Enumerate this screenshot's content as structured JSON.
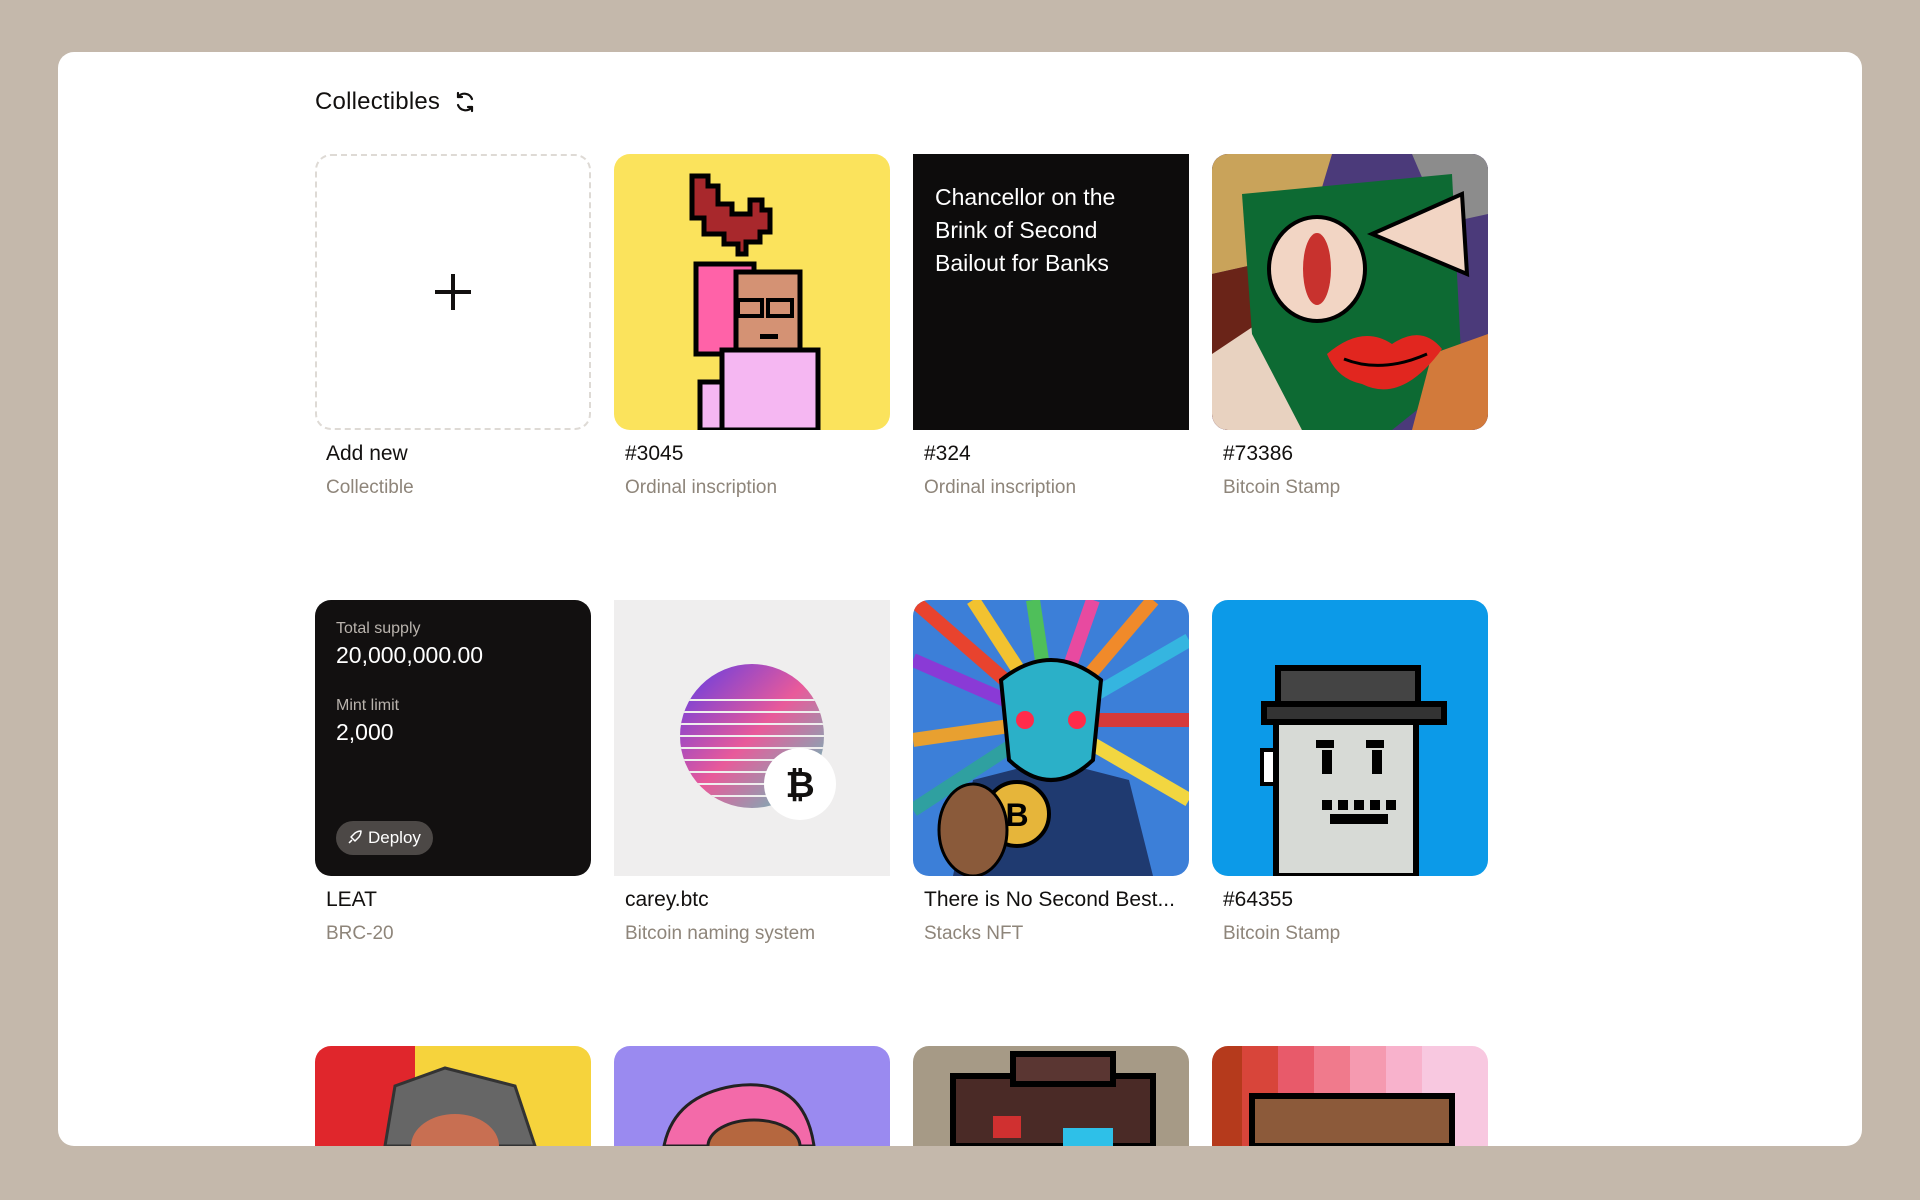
{
  "header": {
    "title": "Collectibles"
  },
  "cards": [
    {
      "title": "Add new",
      "subtitle": "Collectible"
    },
    {
      "title": "#3045",
      "subtitle": "Ordinal inscription"
    },
    {
      "title": "#324",
      "subtitle": "Ordinal inscription",
      "text_lines": [
        "Chancellor on the",
        "Brink of Second",
        "Bailout for Banks"
      ]
    },
    {
      "title": "#73386",
      "subtitle": "Bitcoin Stamp"
    },
    {
      "title": "LEAT",
      "subtitle": "BRC-20",
      "supply_label": "Total supply",
      "supply_value": "20,000,000.00",
      "mint_label": "Mint limit",
      "mint_value": "2,000",
      "deploy_label": "Deploy"
    },
    {
      "title": "carey.btc",
      "subtitle": "Bitcoin naming system",
      "badge": "₿"
    },
    {
      "title": "There is No Second Best...",
      "subtitle": "Stacks NFT"
    },
    {
      "title": "#64355",
      "subtitle": "Bitcoin Stamp"
    }
  ],
  "colors": {
    "background": "#c4b8ab",
    "panel": "#ffffff",
    "subtitle": "#8e857a",
    "yellow": "#fbe35c",
    "blue": "#0c9ae8"
  }
}
